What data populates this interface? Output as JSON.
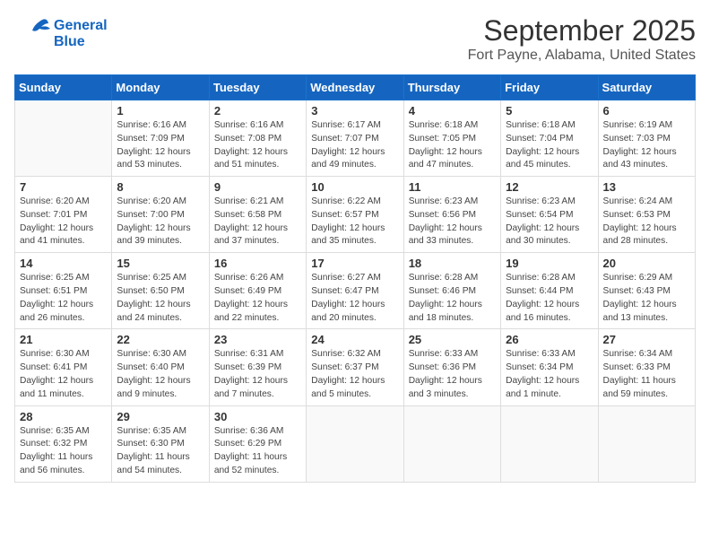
{
  "header": {
    "logo_line1": "General",
    "logo_line2": "Blue",
    "title": "September 2025",
    "subtitle": "Fort Payne, Alabama, United States"
  },
  "weekdays": [
    "Sunday",
    "Monday",
    "Tuesday",
    "Wednesday",
    "Thursday",
    "Friday",
    "Saturday"
  ],
  "weeks": [
    [
      {
        "day": "",
        "info": ""
      },
      {
        "day": "1",
        "info": "Sunrise: 6:16 AM\nSunset: 7:09 PM\nDaylight: 12 hours\nand 53 minutes."
      },
      {
        "day": "2",
        "info": "Sunrise: 6:16 AM\nSunset: 7:08 PM\nDaylight: 12 hours\nand 51 minutes."
      },
      {
        "day": "3",
        "info": "Sunrise: 6:17 AM\nSunset: 7:07 PM\nDaylight: 12 hours\nand 49 minutes."
      },
      {
        "day": "4",
        "info": "Sunrise: 6:18 AM\nSunset: 7:05 PM\nDaylight: 12 hours\nand 47 minutes."
      },
      {
        "day": "5",
        "info": "Sunrise: 6:18 AM\nSunset: 7:04 PM\nDaylight: 12 hours\nand 45 minutes."
      },
      {
        "day": "6",
        "info": "Sunrise: 6:19 AM\nSunset: 7:03 PM\nDaylight: 12 hours\nand 43 minutes."
      }
    ],
    [
      {
        "day": "7",
        "info": "Sunrise: 6:20 AM\nSunset: 7:01 PM\nDaylight: 12 hours\nand 41 minutes."
      },
      {
        "day": "8",
        "info": "Sunrise: 6:20 AM\nSunset: 7:00 PM\nDaylight: 12 hours\nand 39 minutes."
      },
      {
        "day": "9",
        "info": "Sunrise: 6:21 AM\nSunset: 6:58 PM\nDaylight: 12 hours\nand 37 minutes."
      },
      {
        "day": "10",
        "info": "Sunrise: 6:22 AM\nSunset: 6:57 PM\nDaylight: 12 hours\nand 35 minutes."
      },
      {
        "day": "11",
        "info": "Sunrise: 6:23 AM\nSunset: 6:56 PM\nDaylight: 12 hours\nand 33 minutes."
      },
      {
        "day": "12",
        "info": "Sunrise: 6:23 AM\nSunset: 6:54 PM\nDaylight: 12 hours\nand 30 minutes."
      },
      {
        "day": "13",
        "info": "Sunrise: 6:24 AM\nSunset: 6:53 PM\nDaylight: 12 hours\nand 28 minutes."
      }
    ],
    [
      {
        "day": "14",
        "info": "Sunrise: 6:25 AM\nSunset: 6:51 PM\nDaylight: 12 hours\nand 26 minutes."
      },
      {
        "day": "15",
        "info": "Sunrise: 6:25 AM\nSunset: 6:50 PM\nDaylight: 12 hours\nand 24 minutes."
      },
      {
        "day": "16",
        "info": "Sunrise: 6:26 AM\nSunset: 6:49 PM\nDaylight: 12 hours\nand 22 minutes."
      },
      {
        "day": "17",
        "info": "Sunrise: 6:27 AM\nSunset: 6:47 PM\nDaylight: 12 hours\nand 20 minutes."
      },
      {
        "day": "18",
        "info": "Sunrise: 6:28 AM\nSunset: 6:46 PM\nDaylight: 12 hours\nand 18 minutes."
      },
      {
        "day": "19",
        "info": "Sunrise: 6:28 AM\nSunset: 6:44 PM\nDaylight: 12 hours\nand 16 minutes."
      },
      {
        "day": "20",
        "info": "Sunrise: 6:29 AM\nSunset: 6:43 PM\nDaylight: 12 hours\nand 13 minutes."
      }
    ],
    [
      {
        "day": "21",
        "info": "Sunrise: 6:30 AM\nSunset: 6:41 PM\nDaylight: 12 hours\nand 11 minutes."
      },
      {
        "day": "22",
        "info": "Sunrise: 6:30 AM\nSunset: 6:40 PM\nDaylight: 12 hours\nand 9 minutes."
      },
      {
        "day": "23",
        "info": "Sunrise: 6:31 AM\nSunset: 6:39 PM\nDaylight: 12 hours\nand 7 minutes."
      },
      {
        "day": "24",
        "info": "Sunrise: 6:32 AM\nSunset: 6:37 PM\nDaylight: 12 hours\nand 5 minutes."
      },
      {
        "day": "25",
        "info": "Sunrise: 6:33 AM\nSunset: 6:36 PM\nDaylight: 12 hours\nand 3 minutes."
      },
      {
        "day": "26",
        "info": "Sunrise: 6:33 AM\nSunset: 6:34 PM\nDaylight: 12 hours\nand 1 minute."
      },
      {
        "day": "27",
        "info": "Sunrise: 6:34 AM\nSunset: 6:33 PM\nDaylight: 11 hours\nand 59 minutes."
      }
    ],
    [
      {
        "day": "28",
        "info": "Sunrise: 6:35 AM\nSunset: 6:32 PM\nDaylight: 11 hours\nand 56 minutes."
      },
      {
        "day": "29",
        "info": "Sunrise: 6:35 AM\nSunset: 6:30 PM\nDaylight: 11 hours\nand 54 minutes."
      },
      {
        "day": "30",
        "info": "Sunrise: 6:36 AM\nSunset: 6:29 PM\nDaylight: 11 hours\nand 52 minutes."
      },
      {
        "day": "",
        "info": ""
      },
      {
        "day": "",
        "info": ""
      },
      {
        "day": "",
        "info": ""
      },
      {
        "day": "",
        "info": ""
      }
    ]
  ]
}
